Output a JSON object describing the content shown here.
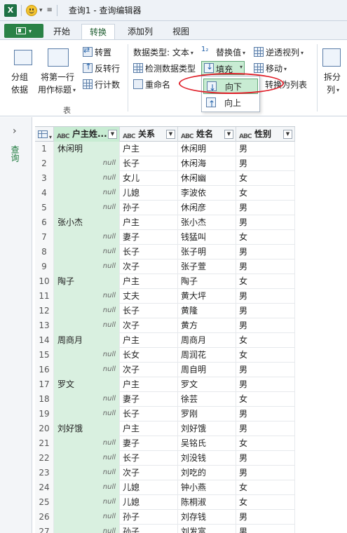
{
  "titlebar": {
    "app_icon": "X",
    "window_title": "查询1 - 查询编辑器"
  },
  "tabs": [
    {
      "label": "开始",
      "active": false
    },
    {
      "label": "转换",
      "active": true
    },
    {
      "label": "添加列",
      "active": false
    },
    {
      "label": "视图",
      "active": false
    }
  ],
  "ribbon": {
    "group_by": {
      "line1": "分组",
      "line2": "依据"
    },
    "use_first_row": {
      "line1": "将第一行",
      "line2": "用作标题"
    },
    "transpose": "转置",
    "reverse_rows": "反转行",
    "count_rows": "行计数",
    "table_group_label": "表",
    "data_type": "数据类型: 文本",
    "detect_type": "检测数据类型",
    "rename": "重命名",
    "replace_values": "替换值",
    "fill": "填充",
    "unpivot": "逆透视列",
    "move": "移动",
    "to_list": "转换为列表",
    "split": {
      "line1": "拆分",
      "line2": "列"
    },
    "fill_menu": {
      "down": "向下",
      "up": "向上"
    }
  },
  "query_pane": {
    "label": "查询"
  },
  "grid": {
    "null_text": "null",
    "columns": [
      {
        "name": "户主姓...",
        "type": "ABC"
      },
      {
        "name": "关系",
        "type": "ABC"
      },
      {
        "name": "姓名",
        "type": "ABC"
      },
      {
        "name": "性别",
        "type": "ABC"
      }
    ],
    "rows": [
      {
        "n": "1",
        "hz": "休闲明",
        "gx": "户主",
        "xm": "休闲明",
        "xb": "男"
      },
      {
        "n": "2",
        "hz": null,
        "gx": "长子",
        "xm": "休闲海",
        "xb": "男"
      },
      {
        "n": "3",
        "hz": null,
        "gx": "女儿",
        "xm": "休闲幽",
        "xb": "女"
      },
      {
        "n": "4",
        "hz": null,
        "gx": "儿媳",
        "xm": "李波依",
        "xb": "女"
      },
      {
        "n": "5",
        "hz": null,
        "gx": "孙子",
        "xm": "休闲彦",
        "xb": "男"
      },
      {
        "n": "6",
        "hz": "张小杰",
        "gx": "户主",
        "xm": "张小杰",
        "xb": "男"
      },
      {
        "n": "7",
        "hz": null,
        "gx": "妻子",
        "xm": "钱猛叫",
        "xb": "女"
      },
      {
        "n": "8",
        "hz": null,
        "gx": "长子",
        "xm": "张子明",
        "xb": "男"
      },
      {
        "n": "9",
        "hz": null,
        "gx": "次子",
        "xm": "张子萱",
        "xb": "男"
      },
      {
        "n": "10",
        "hz": "陶子",
        "gx": "户主",
        "xm": "陶子",
        "xb": "女"
      },
      {
        "n": "11",
        "hz": null,
        "gx": "丈夫",
        "xm": "黄大坪",
        "xb": "男"
      },
      {
        "n": "12",
        "hz": null,
        "gx": "长子",
        "xm": "黄隆",
        "xb": "男"
      },
      {
        "n": "13",
        "hz": null,
        "gx": "次子",
        "xm": "黄方",
        "xb": "男"
      },
      {
        "n": "14",
        "hz": "周商月",
        "gx": "户主",
        "xm": "周商月",
        "xb": "女"
      },
      {
        "n": "15",
        "hz": null,
        "gx": "长女",
        "xm": "周润花",
        "xb": "女"
      },
      {
        "n": "16",
        "hz": null,
        "gx": "次子",
        "xm": "周自明",
        "xb": "男"
      },
      {
        "n": "17",
        "hz": "罗文",
        "gx": "户主",
        "xm": "罗文",
        "xb": "男"
      },
      {
        "n": "18",
        "hz": null,
        "gx": "妻子",
        "xm": "徐芸",
        "xb": "女"
      },
      {
        "n": "19",
        "hz": null,
        "gx": "长子",
        "xm": "罗刚",
        "xb": "男"
      },
      {
        "n": "20",
        "hz": "刘好饿",
        "gx": "户主",
        "xm": "刘好饿",
        "xb": "男"
      },
      {
        "n": "21",
        "hz": null,
        "gx": "妻子",
        "xm": "吴铭氏",
        "xb": "女"
      },
      {
        "n": "22",
        "hz": null,
        "gx": "长子",
        "xm": "刘没钱",
        "xb": "男"
      },
      {
        "n": "23",
        "hz": null,
        "gx": "次子",
        "xm": "刘吃的",
        "xb": "男"
      },
      {
        "n": "24",
        "hz": null,
        "gx": "儿媳",
        "xm": "钟小燕",
        "xb": "女"
      },
      {
        "n": "25",
        "hz": null,
        "gx": "儿媳",
        "xm": "陈桐淑",
        "xb": "女"
      },
      {
        "n": "26",
        "hz": null,
        "gx": "孙子",
        "xm": "刘存钱",
        "xb": "男"
      },
      {
        "n": "27",
        "hz": null,
        "gx": "孙子",
        "xm": "刘发富",
        "xb": "男"
      }
    ]
  }
}
